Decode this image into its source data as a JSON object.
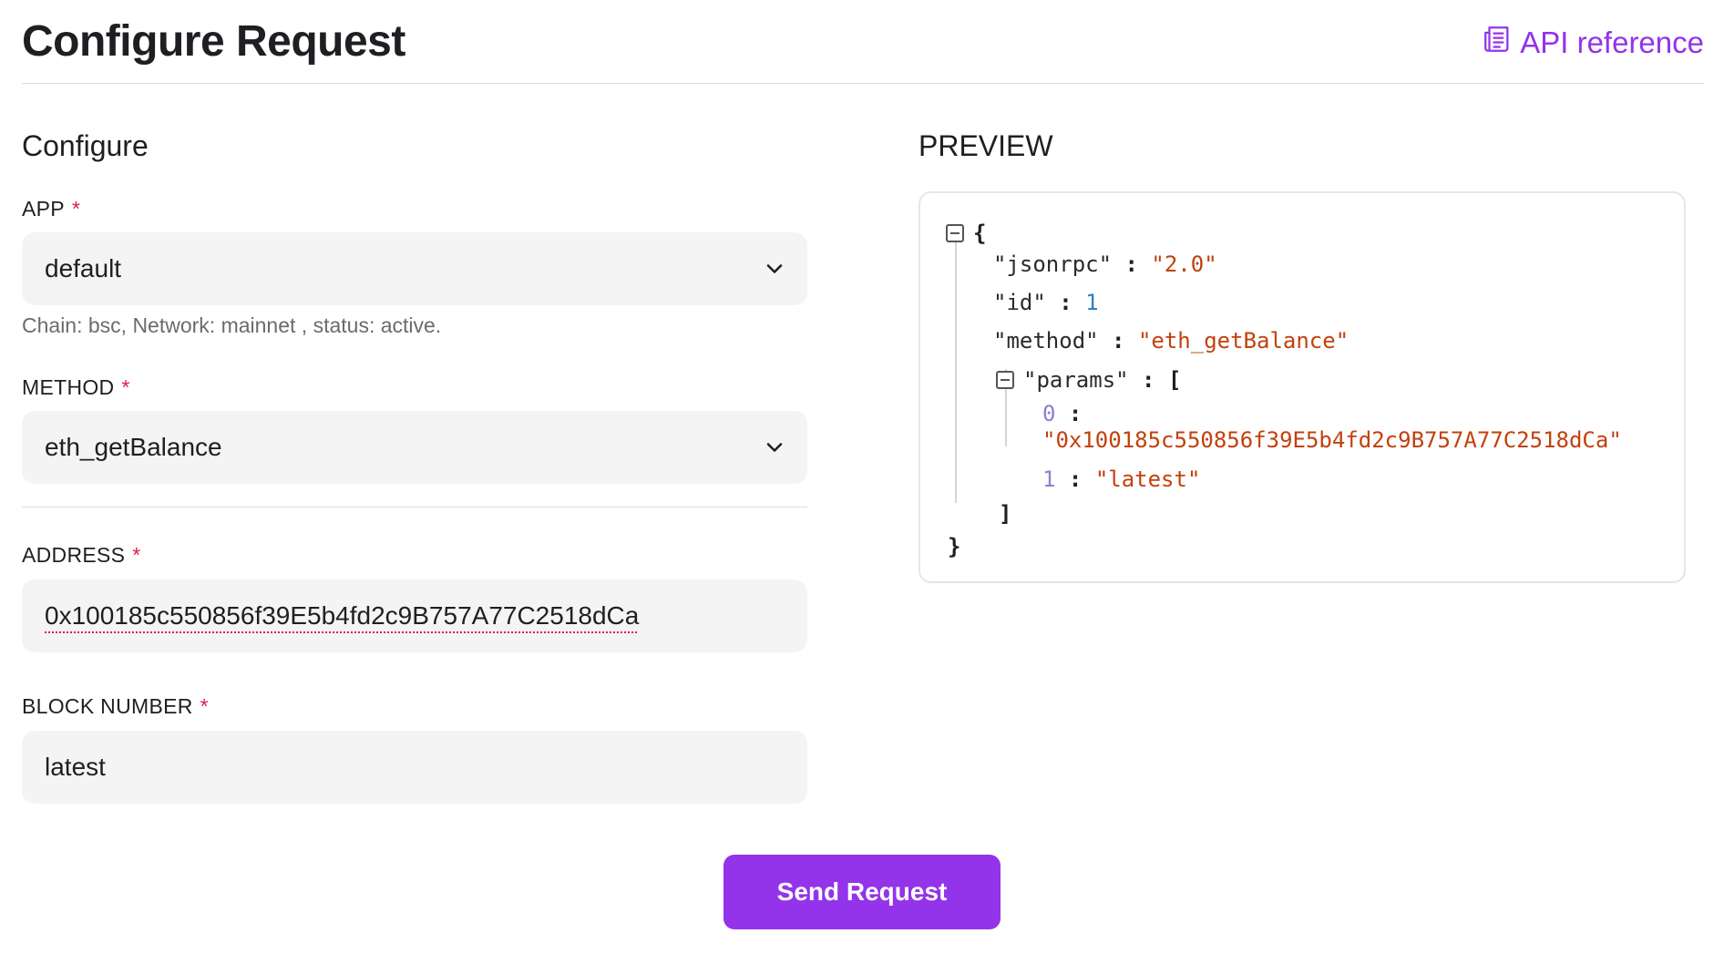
{
  "header": {
    "title": "Configure Request",
    "api_link": "API reference"
  },
  "configure": {
    "title": "Configure",
    "app": {
      "label": "APP",
      "required": "*",
      "value": "default",
      "helper": "Chain: bsc, Network: mainnet , status: active."
    },
    "method": {
      "label": "METHOD",
      "required": "*",
      "value": "eth_getBalance"
    },
    "address": {
      "label": "ADDRESS",
      "required": "*",
      "value": "0x100185c550856f39E5b4fd2c9B757A77C2518dCa"
    },
    "block_number": {
      "label": "BLOCK NUMBER",
      "required": "*",
      "value": "latest"
    }
  },
  "preview": {
    "title": "PREVIEW",
    "json": {
      "open_brace": "{",
      "close_brace": "}",
      "jsonrpc_key": "\"jsonrpc\"",
      "jsonrpc_val": "\"2.0\"",
      "id_key": "\"id\"",
      "id_val": "1",
      "method_key": "\"method\"",
      "method_val": "\"eth_getBalance\"",
      "params_key": "\"params\"",
      "open_bracket": "[",
      "close_bracket": "]",
      "param0_index": "0",
      "param0_val": "\"0x100185c550856f39E5b4fd2c9B757A77C2518dCa\"",
      "param1_index": "1",
      "param1_val": "\"latest\"",
      "colon": ":"
    }
  },
  "actions": {
    "send": "Send Request"
  },
  "colors": {
    "accent": "#9333ea",
    "required": "#e11d48",
    "string": "#c2410c",
    "number": "#2f7fbd"
  }
}
